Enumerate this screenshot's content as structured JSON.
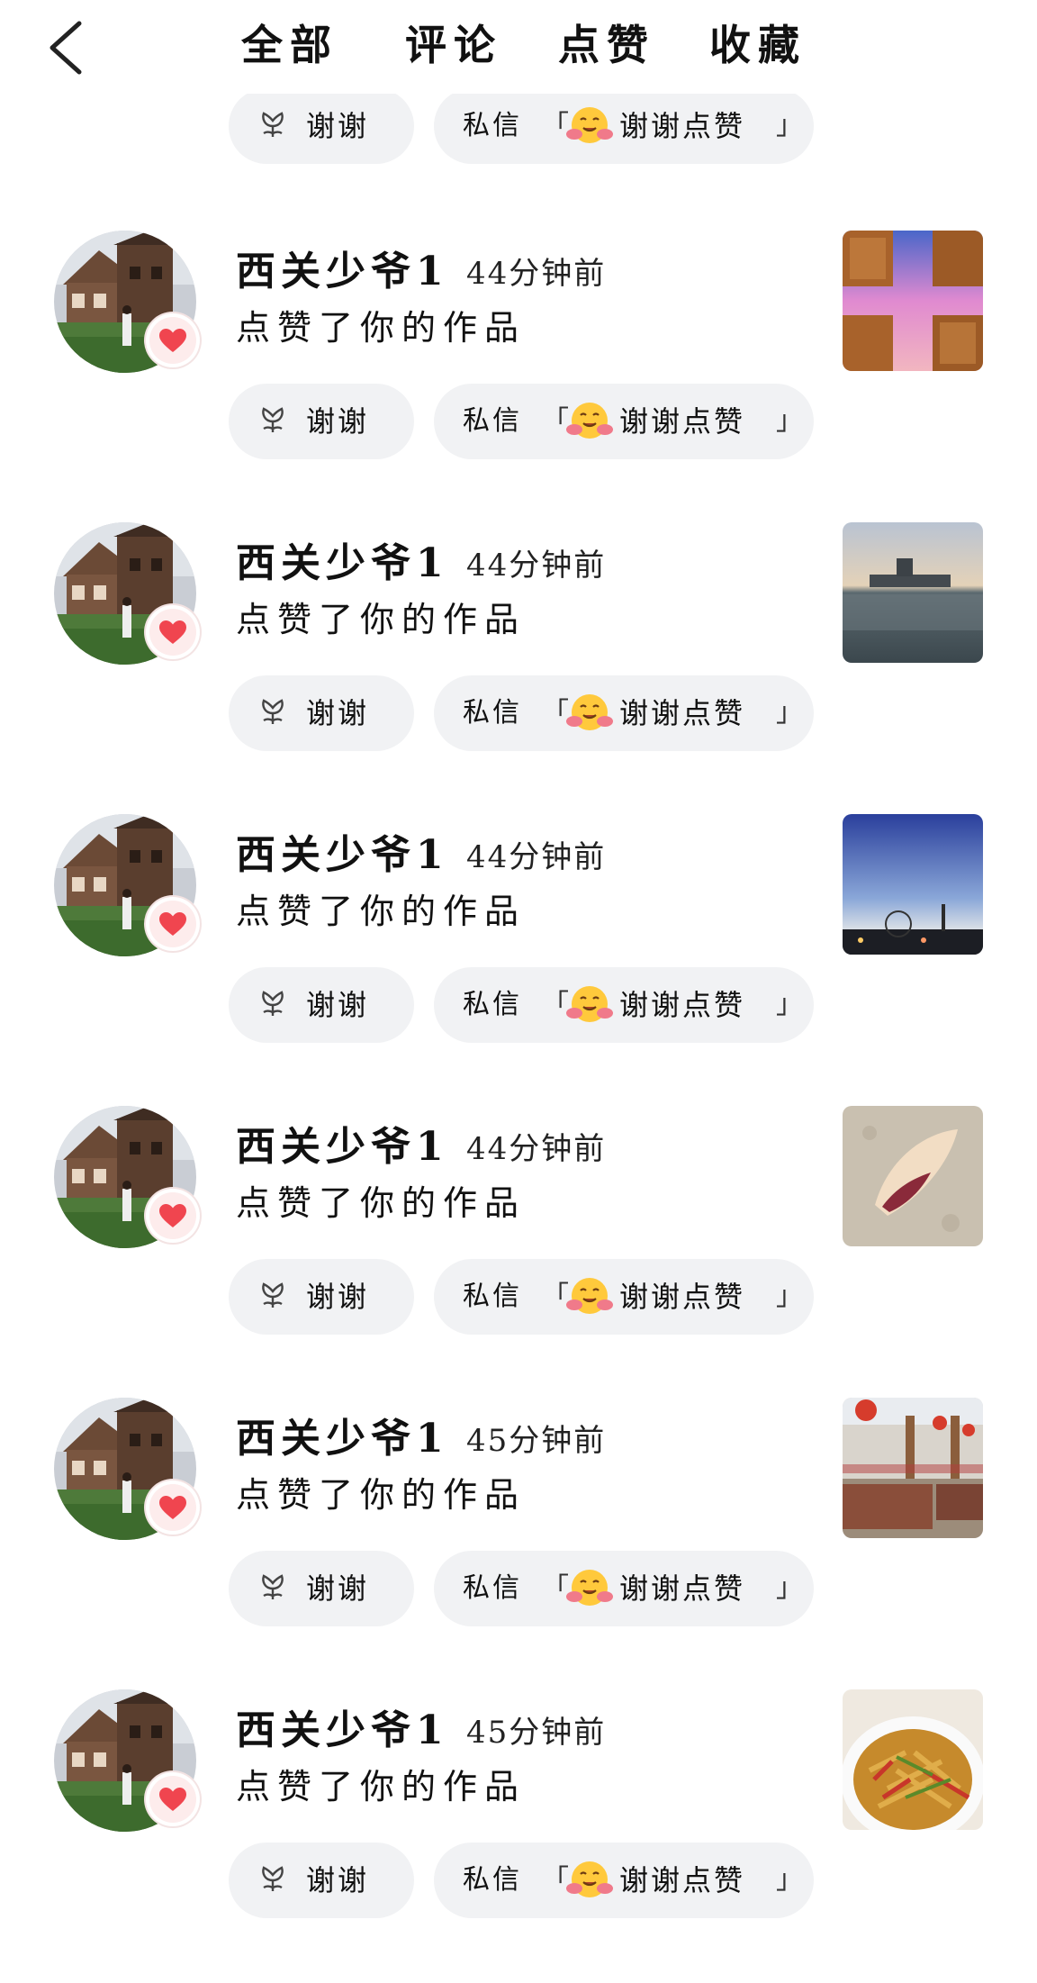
{
  "header": {
    "tabs": [
      {
        "label": "全部"
      },
      {
        "label": "评论"
      },
      {
        "label": "点赞"
      },
      {
        "label": "收藏"
      }
    ]
  },
  "pill_labels": {
    "thanks": "谢谢",
    "dm_prefix": "私信",
    "open_bracket": "「",
    "close_bracket": "」",
    "dm_message": "谢谢点赞"
  },
  "notifications": [
    {
      "username": "西关少爷1",
      "time": "44分钟前",
      "action": "点赞了你的作品"
    },
    {
      "username": "西关少爷1",
      "time": "44分钟前",
      "action": "点赞了你的作品"
    },
    {
      "username": "西关少爷1",
      "time": "44分钟前",
      "action": "点赞了你的作品"
    },
    {
      "username": "西关少爷1",
      "time": "44分钟前",
      "action": "点赞了你的作品"
    },
    {
      "username": "西关少爷1",
      "time": "45分钟前",
      "action": "点赞了你的作品"
    },
    {
      "username": "西关少爷1",
      "time": "45分钟前",
      "action": "点赞了你的作品"
    }
  ],
  "colors": {
    "pill_bg": "#f1f2f4",
    "heart": "#f0454f",
    "heart_badge_bg": "#fdecec"
  },
  "icons": [
    "back-arrow-icon",
    "flower-icon",
    "hug-emoji-icon",
    "heart-icon"
  ]
}
